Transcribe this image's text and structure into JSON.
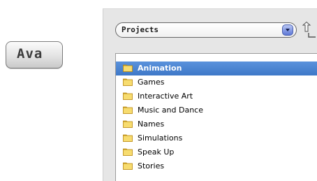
{
  "left_button": {
    "label": "Ava"
  },
  "dialog": {
    "folder_select": {
      "selected": "Projects",
      "arrow_icon": "chevron-down-icon"
    },
    "up_button_icon": "folder-up-icon",
    "files": [
      {
        "label": "Animation",
        "selected": true
      },
      {
        "label": "Games",
        "selected": false
      },
      {
        "label": "Interactive Art",
        "selected": false
      },
      {
        "label": "Music and Dance",
        "selected": false
      },
      {
        "label": "Names",
        "selected": false
      },
      {
        "label": "Simulations",
        "selected": false
      },
      {
        "label": "Speak Up",
        "selected": false
      },
      {
        "label": "Stories",
        "selected": false
      }
    ]
  },
  "colors": {
    "selection": "#4a86d4",
    "folder_fill": "#f7dc6f",
    "folder_stroke": "#b8860b",
    "panel_bg": "#e6e6e6"
  }
}
